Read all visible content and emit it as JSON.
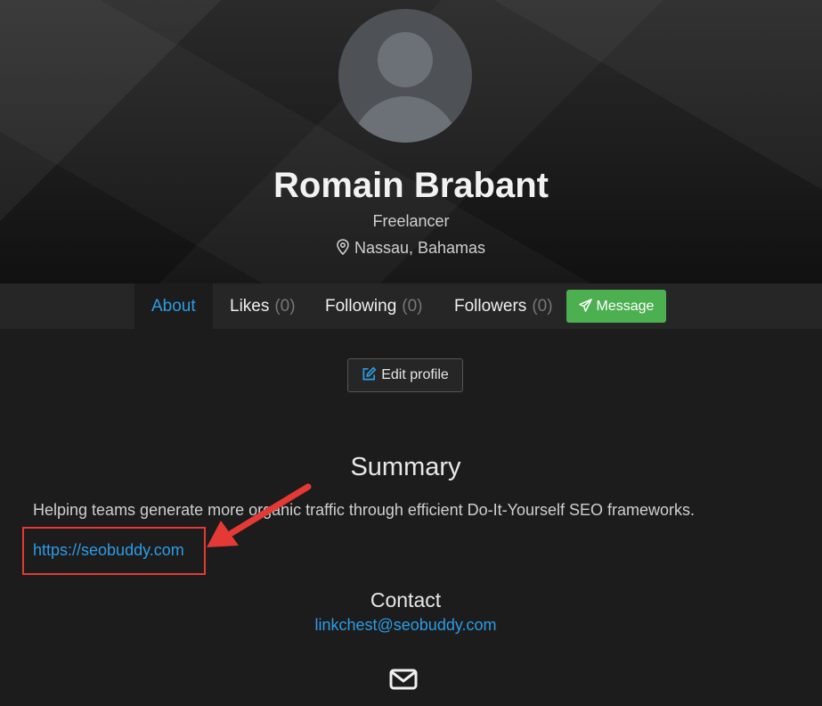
{
  "profile": {
    "name": "Romain Brabant",
    "role": "Freelancer",
    "location": "Nassau, Bahamas"
  },
  "nav": {
    "tabs": [
      {
        "label": "About",
        "count": ""
      },
      {
        "label": "Likes",
        "count": "(0)"
      },
      {
        "label": "Following",
        "count": "(0)"
      },
      {
        "label": "Followers",
        "count": "(0)"
      }
    ],
    "message_label": "Message"
  },
  "actions": {
    "edit_profile_label": "Edit profile"
  },
  "summary": {
    "title": "Summary",
    "text": "Helping teams generate more organic traffic through efficient Do-It-Yourself SEO frameworks.",
    "website": "https://seobuddy.com"
  },
  "contact": {
    "title": "Contact",
    "email": "linkchest@seobuddy.com"
  },
  "colors": {
    "accent": "#2d9ce6",
    "message_button": "#4caf50",
    "annotation": "#e53935"
  },
  "icons": [
    "map-pin-icon",
    "paper-plane-icon",
    "edit-icon",
    "envelope-icon"
  ]
}
